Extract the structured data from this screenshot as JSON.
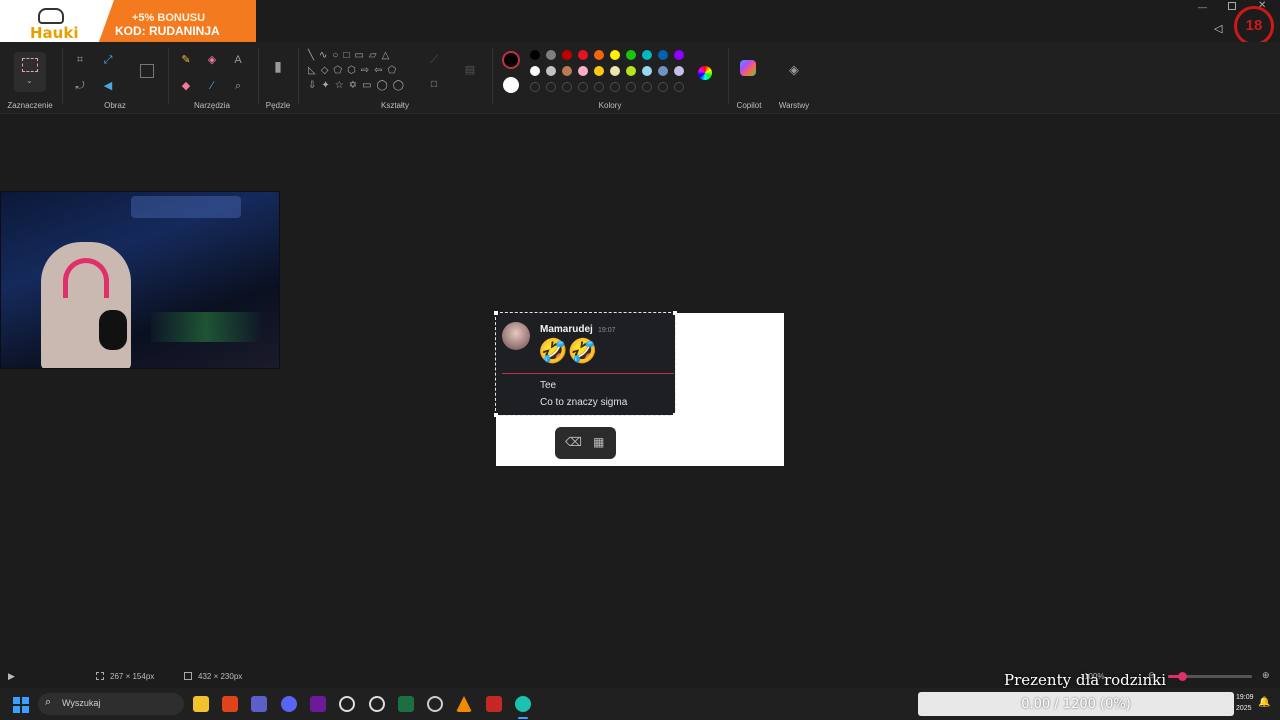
{
  "promo": {
    "logo_text": "Hauki",
    "bonus": "+5% BONUSU",
    "code": "KOD: RUDANINJA"
  },
  "ribbon": {
    "groups": {
      "selection": "Zaznaczenie",
      "image": "Obraz",
      "tools": "Narzędzia",
      "brushes": "Pędzle",
      "shapes": "Kształty",
      "colors": "Kolory",
      "copilot": "Copilot",
      "layers": "Warstwy"
    },
    "palette_row1": [
      "#000000",
      "#7f7f7f",
      "#c00000",
      "#e81123",
      "#f7630c",
      "#fff100",
      "#16c60c",
      "#00b7c3",
      "#0063b1",
      "#8e00ff"
    ],
    "palette_row2": [
      "#ffffff",
      "#c3c3c3",
      "#b97a57",
      "#ffaec9",
      "#ffc90e",
      "#efe4b0",
      "#b5e61d",
      "#99d9ea",
      "#7092be",
      "#c8bfe7"
    ]
  },
  "chat": {
    "username": "Mamarudej",
    "time": "19:07",
    "emoji": "🤣🤣",
    "lines": [
      "Tee",
      "Co to znaczy sigma"
    ]
  },
  "status": {
    "selection_size": "267 × 154px",
    "canvas_size": "432 × 230px",
    "zoom": "100%"
  },
  "taskbar": {
    "search_placeholder": "Wyszukaj",
    "time": "19:09",
    "date": "2025"
  },
  "overlay": {
    "gift_title": "Prezenty dla rodzinki",
    "gift_progress": "0.00 / 1200 (0%)"
  },
  "colors": {
    "accent": "#f47a20",
    "dark": "#1c1c1c"
  }
}
